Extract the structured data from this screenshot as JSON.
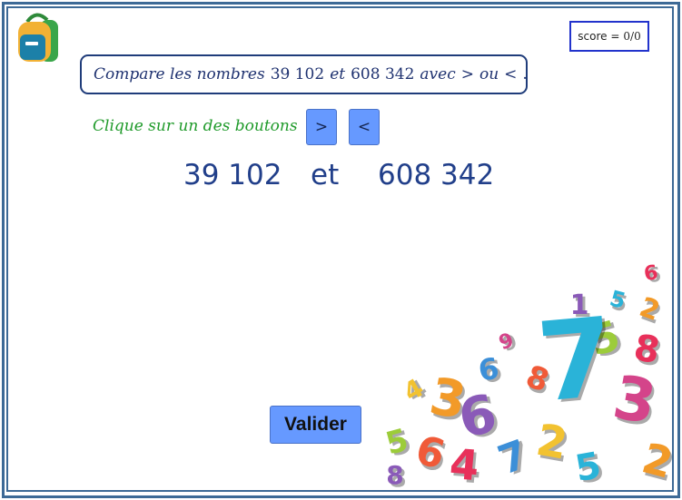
{
  "score": {
    "label": "score =",
    "value": "0/0"
  },
  "question": {
    "prefix": "Compare les nombres",
    "number_a": "39 102",
    "connector": "et",
    "number_b": "608 342",
    "avec": "avec",
    "sym_gt": ">",
    "ou": "ou",
    "sym_lt": "<",
    "end": "."
  },
  "instruction": "Clique sur un des boutons",
  "buttons": {
    "greater": ">",
    "less": "<",
    "validate": "Valider"
  },
  "display": {
    "left_number": "39 102",
    "word": "et",
    "right_number": "608 342"
  },
  "decoration": {
    "icon": "colorful-3d-numbers",
    "digits": [
      "6",
      "5",
      "2",
      "1",
      "5",
      "9",
      "8",
      "6",
      "4",
      "8",
      "7",
      "3",
      "6",
      "5",
      "3",
      "6",
      "7",
      "2",
      "4",
      "5",
      "2",
      "8"
    ]
  },
  "colors": {
    "border": "#3d6a96",
    "button": "#6699ff",
    "question_text": "#1f3270",
    "instruction_text": "#1f9a2a",
    "numbers_text": "#213f8a",
    "score_border": "#2233cc"
  }
}
